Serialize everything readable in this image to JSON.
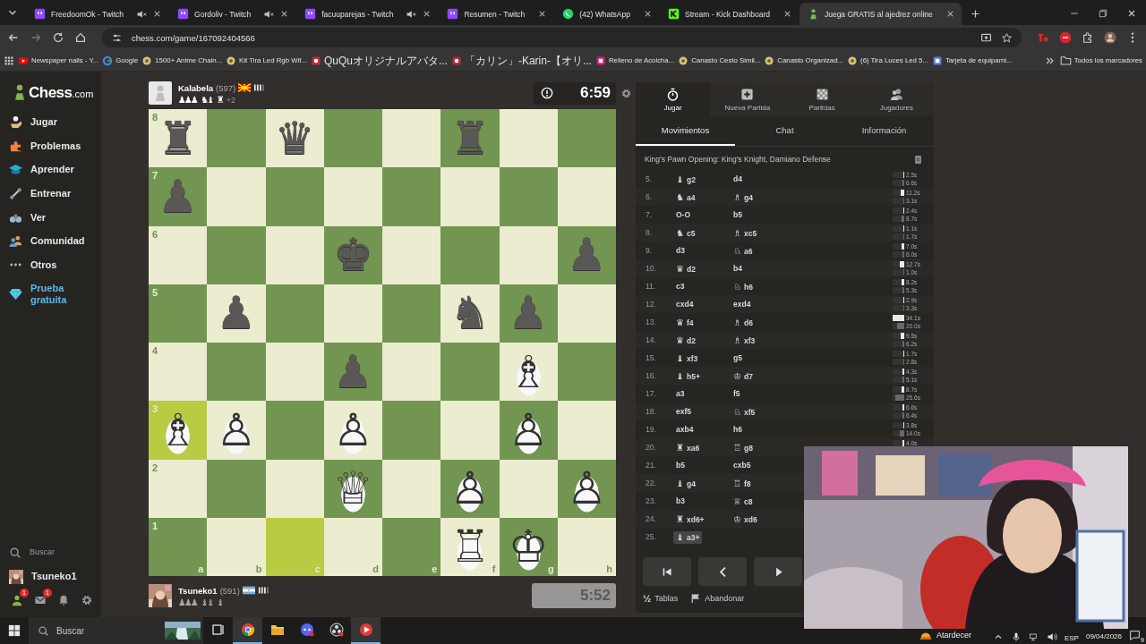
{
  "browser": {
    "tabs": [
      {
        "title": "FreedoomOk - Twitch",
        "kind": "twitch",
        "muted": true,
        "selected": false
      },
      {
        "title": "Gordoliv - Twitch",
        "kind": "twitch",
        "muted": true,
        "selected": false
      },
      {
        "title": "facuuparejas - Twitch",
        "kind": "twitch",
        "muted": true,
        "selected": false
      },
      {
        "title": "Resumen - Twitch",
        "kind": "twitch",
        "muted": false,
        "selected": false
      },
      {
        "title": "(42) WhatsApp",
        "kind": "whatsapp",
        "muted": false,
        "selected": false
      },
      {
        "title": "Stream - Kick Dashboard",
        "kind": "kick",
        "muted": false,
        "selected": false
      },
      {
        "title": "Juega GRATIS al ajedrez online",
        "kind": "chess",
        "muted": false,
        "selected": true
      }
    ],
    "address": "chess.com/game/167092404566",
    "bookmarks": [
      {
        "label": "Newspaper nails - Y...",
        "kind": "video",
        "color": "#ff0000"
      },
      {
        "label": "Google",
        "kind": "search",
        "color": "#4285f4"
      },
      {
        "label": "1500+ Anime Chain...",
        "kind": "shop",
        "color": "#d8c27a"
      },
      {
        "label": "Kit Tira Led Rgb Wif...",
        "kind": "shop",
        "color": "#d8c27a"
      },
      {
        "label": "QuQuオリジナルアバタ...",
        "kind": "avatar",
        "color": "#c8283c"
      },
      {
        "label": "「カリン」-Karin-【オリ...",
        "kind": "avatar",
        "color": "#b52a3a"
      },
      {
        "label": "Relleno de Acolcha...",
        "kind": "site",
        "color": "#e0177a"
      },
      {
        "label": "Canasto Cesto Simil...",
        "kind": "shop",
        "color": "#d8c27a"
      },
      {
        "label": "Canasto Organizad...",
        "kind": "shop",
        "color": "#d8c27a"
      },
      {
        "label": "(6) Tira Luces Led 5...",
        "kind": "shop",
        "color": "#d8c27a"
      },
      {
        "label": "Tarjeta de equipami...",
        "kind": "site",
        "color": "#5b7bd5"
      }
    ],
    "all_bookmarks": "Todos los marcadores"
  },
  "sidebar": {
    "logo": {
      "name": "Chess",
      "suffix": ".com"
    },
    "items": [
      {
        "label": "Jugar",
        "kind": "play"
      },
      {
        "label": "Problemas",
        "kind": "puzzles"
      },
      {
        "label": "Aprender",
        "kind": "learn"
      },
      {
        "label": "Entrenar",
        "kind": "train"
      },
      {
        "label": "Ver",
        "kind": "watch"
      },
      {
        "label": "Comunidad",
        "kind": "community"
      },
      {
        "label": "Otros",
        "kind": "more"
      },
      {
        "label": "Prueba gratuita",
        "kind": "trial"
      }
    ],
    "search": "Buscar",
    "user": "Tsuneko1",
    "notifications": [
      {
        "kind": "friends",
        "badge": "1"
      },
      {
        "kind": "mail",
        "badge": "1"
      },
      {
        "kind": "bell"
      },
      {
        "kind": "settings"
      }
    ]
  },
  "top_player": {
    "name": "Kalabela",
    "rating": "(597)",
    "captured": [
      {
        "glyphs": "♟♟♟",
        "kind": "white"
      },
      {
        "glyphs": "♞♝",
        "kind": "white"
      },
      {
        "glyphs": "♜",
        "kind": "white"
      }
    ],
    "advantage": "+2"
  },
  "top_clock": {
    "time": "6:59",
    "kind": "dark",
    "alert": true
  },
  "board": {
    "ranks": [
      "8",
      "7",
      "6",
      "5",
      "4",
      "3",
      "2",
      "1"
    ],
    "files": [
      "a",
      "b",
      "c",
      "d",
      "e",
      "f",
      "g",
      "h"
    ],
    "rows": [
      [
        {
          "glyph": "♜",
          "kind": "black",
          "highlight": false
        },
        {
          "highlight": false
        },
        {
          "glyph": "♛",
          "kind": "black",
          "highlight": false
        },
        {
          "highlight": false
        },
        {
          "highlight": false
        },
        {
          "glyph": "♜",
          "kind": "black",
          "highlight": false
        },
        {
          "highlight": false
        },
        {
          "highlight": false
        }
      ],
      [
        {
          "glyph": "♟",
          "kind": "black",
          "highlight": false
        },
        {
          "highlight": false
        },
        {
          "highlight": false
        },
        {
          "highlight": false
        },
        {
          "highlight": false
        },
        {
          "highlight": false
        },
        {
          "highlight": false
        },
        {
          "highlight": false
        }
      ],
      [
        {
          "highlight": false
        },
        {
          "highlight": false
        },
        {
          "highlight": false
        },
        {
          "glyph": "♚",
          "kind": "black",
          "highlight": false
        },
        {
          "highlight": false
        },
        {
          "highlight": false
        },
        {
          "highlight": false
        },
        {
          "glyph": "♟",
          "kind": "black",
          "highlight": false
        }
      ],
      [
        {
          "highlight": false
        },
        {
          "glyph": "♟",
          "kind": "black",
          "highlight": false
        },
        {
          "highlight": false
        },
        {
          "highlight": false
        },
        {
          "highlight": false
        },
        {
          "glyph": "♞",
          "kind": "black",
          "highlight": false
        },
        {
          "glyph": "♟",
          "kind": "black",
          "highlight": false
        },
        {
          "highlight": false
        }
      ],
      [
        {
          "highlight": false
        },
        {
          "highlight": false
        },
        {
          "highlight": false
        },
        {
          "glyph": "♟",
          "kind": "black",
          "highlight": false
        },
        {
          "highlight": false
        },
        {
          "highlight": false
        },
        {
          "glyph": "♗",
          "kind": "white",
          "highlight": false
        },
        {
          "highlight": false
        }
      ],
      [
        {
          "glyph": "♗",
          "kind": "white",
          "highlight": true
        },
        {
          "glyph": "♙",
          "kind": "white",
          "highlight": false
        },
        {
          "highlight": false
        },
        {
          "glyph": "♙",
          "kind": "white",
          "highlight": false
        },
        {
          "highlight": false
        },
        {
          "highlight": false
        },
        {
          "glyph": "♙",
          "kind": "white",
          "highlight": false
        },
        {
          "highlight": false
        }
      ],
      [
        {
          "highlight": false
        },
        {
          "highlight": false
        },
        {
          "highlight": false
        },
        {
          "glyph": "♕",
          "kind": "white",
          "highlight": false
        },
        {
          "highlight": false
        },
        {
          "glyph": "♙",
          "kind": "white",
          "highlight": false
        },
        {
          "highlight": false
        },
        {
          "glyph": "♙",
          "kind": "white",
          "highlight": false
        }
      ],
      [
        {
          "highlight": false
        },
        {
          "highlight": false
        },
        {
          "highlight": true
        },
        {
          "highlight": false
        },
        {
          "highlight": false
        },
        {
          "glyph": "♖",
          "kind": "white",
          "highlight": false
        },
        {
          "glyph": "♔",
          "kind": "white",
          "highlight": false
        },
        {
          "highlight": false
        }
      ]
    ]
  },
  "bottom_player": {
    "name": "Tsuneko1",
    "rating": "(591)",
    "captured": [
      {
        "glyphs": "♟♟♟",
        "kind": "black"
      },
      {
        "glyphs": "♝♝",
        "kind": "black"
      },
      {
        "glyphs": "♝",
        "kind": "black"
      }
    ]
  },
  "bottom_clock": {
    "time": "5:52",
    "kind": "light",
    "alert": false
  },
  "panel": {
    "nav": [
      {
        "label": "Jugar",
        "kind": "play",
        "selected": true
      },
      {
        "label": "Nueva Partida",
        "kind": "new",
        "selected": false
      },
      {
        "label": "Partidas",
        "kind": "games",
        "selected": false
      },
      {
        "label": "Jugadores",
        "kind": "players",
        "selected": false
      }
    ],
    "tabs": [
      {
        "label": "Movimientos",
        "selected": true
      },
      {
        "label": "Chat",
        "selected": false
      },
      {
        "label": "Información",
        "selected": false
      }
    ],
    "opening": "King's Pawn Opening: King's Knight, Damiano Defense",
    "moves": [
      {
        "number": "5.",
        "white": {
          "piece": "♝",
          "san": "g2",
          "time": "2.5s",
          "level": 0.07,
          "selected": false
        },
        "black": {
          "san": "d4",
          "time": "6.6s",
          "level": 0.19,
          "selected": false
        }
      },
      {
        "number": "6.",
        "white": {
          "piece": "♞",
          "san": "a4",
          "time": "11.2s",
          "level": 0.33,
          "selected": false
        },
        "black": {
          "piece": "♗",
          "san": "g4",
          "time": "3.1s",
          "level": 0.09,
          "selected": false
        }
      },
      {
        "number": "7.",
        "white": {
          "san": "O-O",
          "time": "2.4s",
          "level": 0.07,
          "selected": false
        },
        "black": {
          "san": "b5",
          "time": "8.7s",
          "level": 0.26,
          "selected": false
        }
      },
      {
        "number": "8.",
        "white": {
          "piece": "♞",
          "san": "c5",
          "time": "1.1s",
          "level": 0.03,
          "selected": false
        },
        "black": {
          "piece": "♗",
          "san": "xc5",
          "time": "1.7s",
          "level": 0.05,
          "selected": false
        }
      },
      {
        "number": "9.",
        "white": {
          "san": "d3",
          "time": "7.0s",
          "level": 0.21,
          "selected": false
        },
        "black": {
          "piece": "♘",
          "san": "a6",
          "time": "6.0s",
          "level": 0.18,
          "selected": false
        }
      },
      {
        "number": "10.",
        "white": {
          "piece": "♛",
          "san": "d2",
          "time": "12.7s",
          "level": 0.37,
          "selected": false
        },
        "black": {
          "san": "b4",
          "time": "1.0s",
          "level": 0.03,
          "selected": false
        }
      },
      {
        "number": "11.",
        "white": {
          "san": "c3",
          "time": "8.2s",
          "level": 0.24,
          "selected": false
        },
        "black": {
          "piece": "♘",
          "san": "h6",
          "time": "5.3s",
          "level": 0.16,
          "selected": false
        }
      },
      {
        "number": "12.",
        "white": {
          "san": "cxd4",
          "time": "2.9s",
          "level": 0.09,
          "selected": false
        },
        "black": {
          "san": "exd4",
          "time": "3.3s",
          "level": 0.1,
          "selected": false
        }
      },
      {
        "number": "13.",
        "white": {
          "piece": "♛",
          "san": "f4",
          "time": "34.1s",
          "level": 1,
          "selected": false
        },
        "black": {
          "piece": "♗",
          "san": "d6",
          "time": "20.0s",
          "level": 0.59,
          "selected": false
        }
      },
      {
        "number": "14.",
        "white": {
          "piece": "♛",
          "san": "d2",
          "time": "9.5s",
          "level": 0.28,
          "selected": false
        },
        "black": {
          "piece": "♗",
          "san": "xf3",
          "time": "6.2s",
          "level": 0.18,
          "selected": false
        }
      },
      {
        "number": "15.",
        "white": {
          "piece": "♝",
          "san": "xf3",
          "time": "1.7s",
          "level": 0.05,
          "selected": false
        },
        "black": {
          "san": "g5",
          "time": "2.8s",
          "level": 0.08,
          "selected": false
        }
      },
      {
        "number": "16.",
        "white": {
          "piece": "♝",
          "san": "h5+",
          "time": "4.3s",
          "level": 0.13,
          "selected": false
        },
        "black": {
          "piece": "♔",
          "san": "d7",
          "time": "5.1s",
          "level": 0.15,
          "selected": false
        }
      },
      {
        "number": "17.",
        "white": {
          "san": "a3",
          "time": "8.7s",
          "level": 0.26,
          "selected": false
        },
        "black": {
          "san": "f5",
          "time": "25.6s",
          "level": 0.75,
          "selected": false
        }
      },
      {
        "number": "18.",
        "white": {
          "san": "exf5",
          "time": "6.6s",
          "level": 0.19,
          "selected": false
        },
        "black": {
          "piece": "♘",
          "san": "xf5",
          "time": "6.4s",
          "level": 0.19,
          "selected": false
        }
      },
      {
        "number": "19.",
        "white": {
          "san": "axb4",
          "time": "3.8s",
          "level": 0.11,
          "selected": false
        },
        "black": {
          "san": "h6",
          "time": "14.0s",
          "level": 0.41,
          "selected": false
        }
      },
      {
        "number": "20.",
        "white": {
          "piece": "♜",
          "san": "xa6",
          "time": "4.0s",
          "level": 0.12,
          "selected": false
        },
        "black": {
          "piece": "♖",
          "san": "g8",
          "selected": false
        }
      },
      {
        "number": "21.",
        "white": {
          "san": "b5",
          "selected": false
        },
        "black": {
          "san": "cxb5",
          "selected": false
        }
      },
      {
        "number": "22.",
        "white": {
          "piece": "♝",
          "san": "g4",
          "selected": false
        },
        "black": {
          "piece": "♖",
          "san": "f8",
          "selected": false
        }
      },
      {
        "number": "23.",
        "white": {
          "san": "b3",
          "selected": false
        },
        "black": {
          "piece": "♕",
          "san": "c8",
          "selected": false
        }
      },
      {
        "number": "24.",
        "white": {
          "piece": "♜",
          "san": "xd6+",
          "selected": false
        },
        "black": {
          "piece": "♔",
          "san": "xd6",
          "selected": false
        }
      },
      {
        "number": "25.",
        "white": {
          "piece": "♝",
          "san": "a3+",
          "selected": true
        }
      }
    ],
    "controls": [
      {
        "kind": "first"
      },
      {
        "kind": "prev"
      },
      {
        "kind": "next"
      }
    ],
    "actions": [
      {
        "kind": "draw",
        "glyph": "½",
        "label": "Tablas"
      },
      {
        "kind": "resign",
        "label": "Abandonar"
      }
    ]
  },
  "taskbar": {
    "search": "Buscar",
    "apps": [
      {
        "kind": "taskview",
        "selected": false
      },
      {
        "kind": "chrome",
        "selected": true
      },
      {
        "kind": "folder",
        "selected": false
      },
      {
        "kind": "chat",
        "selected": false
      },
      {
        "kind": "record",
        "selected": false
      },
      {
        "kind": "video",
        "selected": true
      }
    ],
    "weather": "Atardecer",
    "language": "ESP",
    "date": "09/04/2026",
    "notification_count": "9"
  }
}
